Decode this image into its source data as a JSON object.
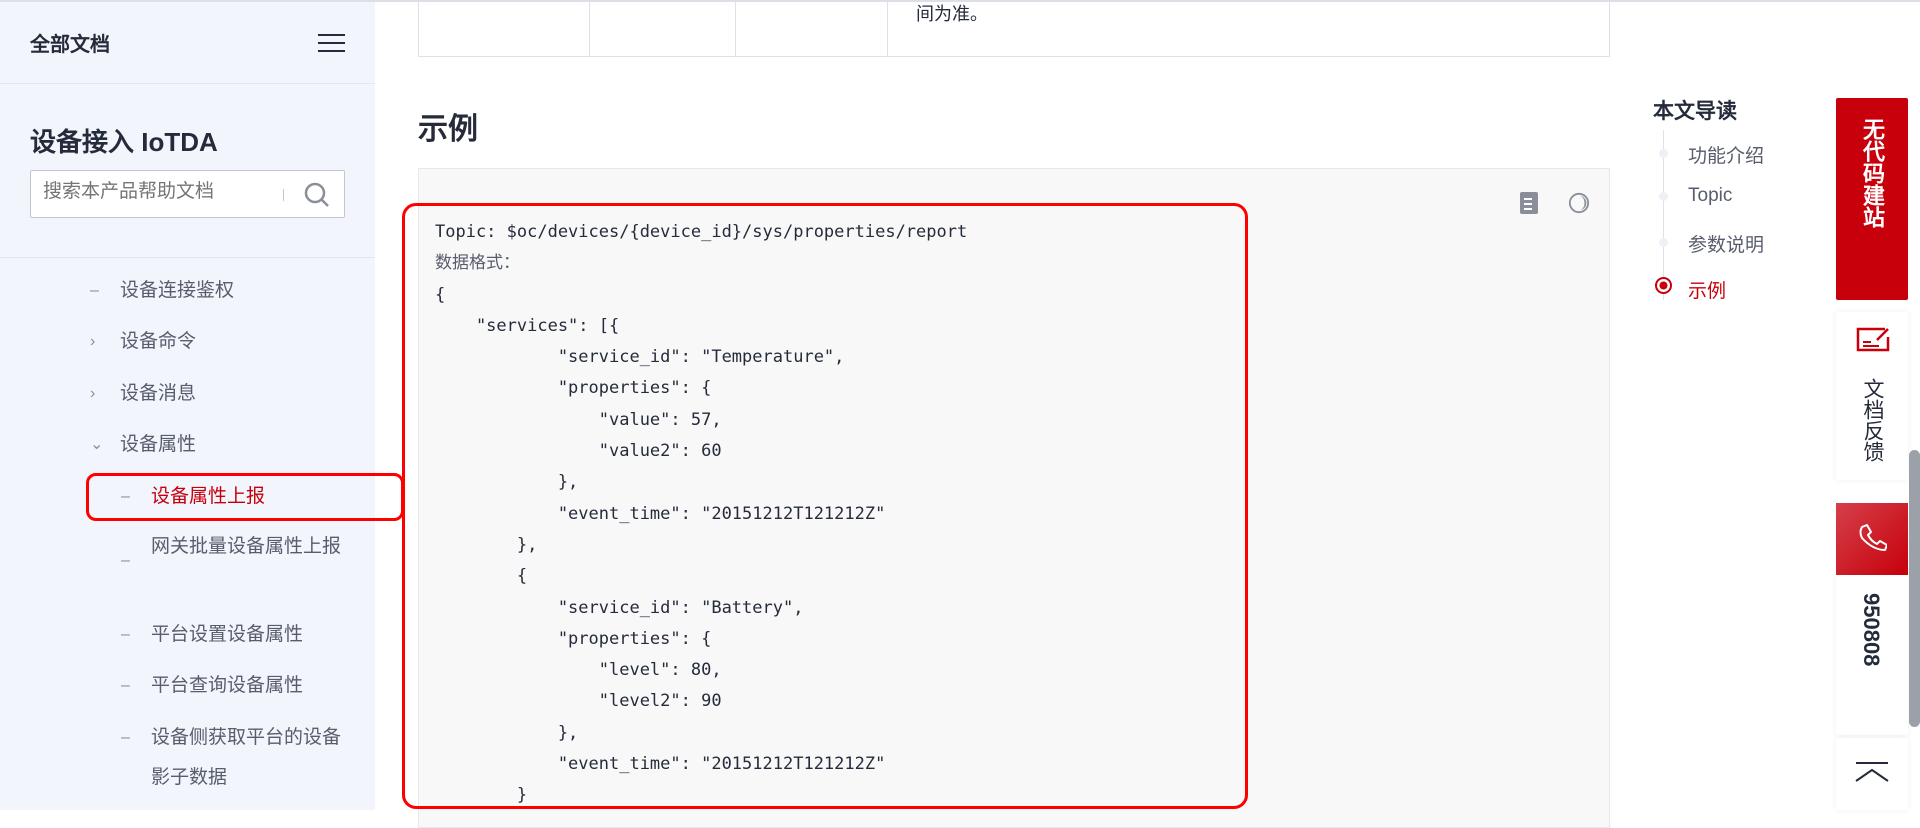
{
  "sidebar": {
    "header": "全部文档",
    "product_title": "设备接入 IoTDA",
    "search_placeholder": "搜索本产品帮助文档",
    "items": [
      {
        "label": "设备连接鉴权",
        "icon": "dash"
      },
      {
        "label": "设备命令",
        "icon": "chevron-right"
      },
      {
        "label": "设备消息",
        "icon": "chevron-right"
      },
      {
        "label": "设备属性",
        "icon": "chevron-down"
      }
    ],
    "subitems": [
      {
        "label": "设备属性上报",
        "active": true
      },
      {
        "label": "网关批量设备属性上报"
      },
      {
        "label": "平台设置设备属性"
      },
      {
        "label": "平台查询设备属性"
      },
      {
        "label": "设备侧获取平台的设备影子数据"
      }
    ]
  },
  "main": {
    "table_tail_text": "间为准。",
    "section_title": "示例",
    "code_lines": [
      "Topic: $oc/devices/{device_id}/sys/properties/report",
      "数据格式：",
      "{",
      "    \"services\": [{",
      "            \"service_id\": \"Temperature\",",
      "            \"properties\": {",
      "                \"value\": 57,",
      "                \"value2\": 60",
      "            },",
      "            \"event_time\": \"20151212T121212Z\"",
      "        },",
      "        {",
      "            \"service_id\": \"Battery\",",
      "            \"properties\": {",
      "                \"level\": 80,",
      "                \"level2\": 90",
      "            },",
      "            \"event_time\": \"20151212T121212Z\"",
      "        }"
    ]
  },
  "toc": {
    "title": "本文导读",
    "items": [
      {
        "label": "功能介绍"
      },
      {
        "label": "Topic"
      },
      {
        "label": "参数说明"
      },
      {
        "label": "示例",
        "active": true
      }
    ]
  },
  "float": {
    "lowcode": "无代码建站",
    "feedback": "文档反馈",
    "phone": "950808"
  },
  "colors": {
    "accent": "#c7000b",
    "highlight": "#ff0000"
  }
}
